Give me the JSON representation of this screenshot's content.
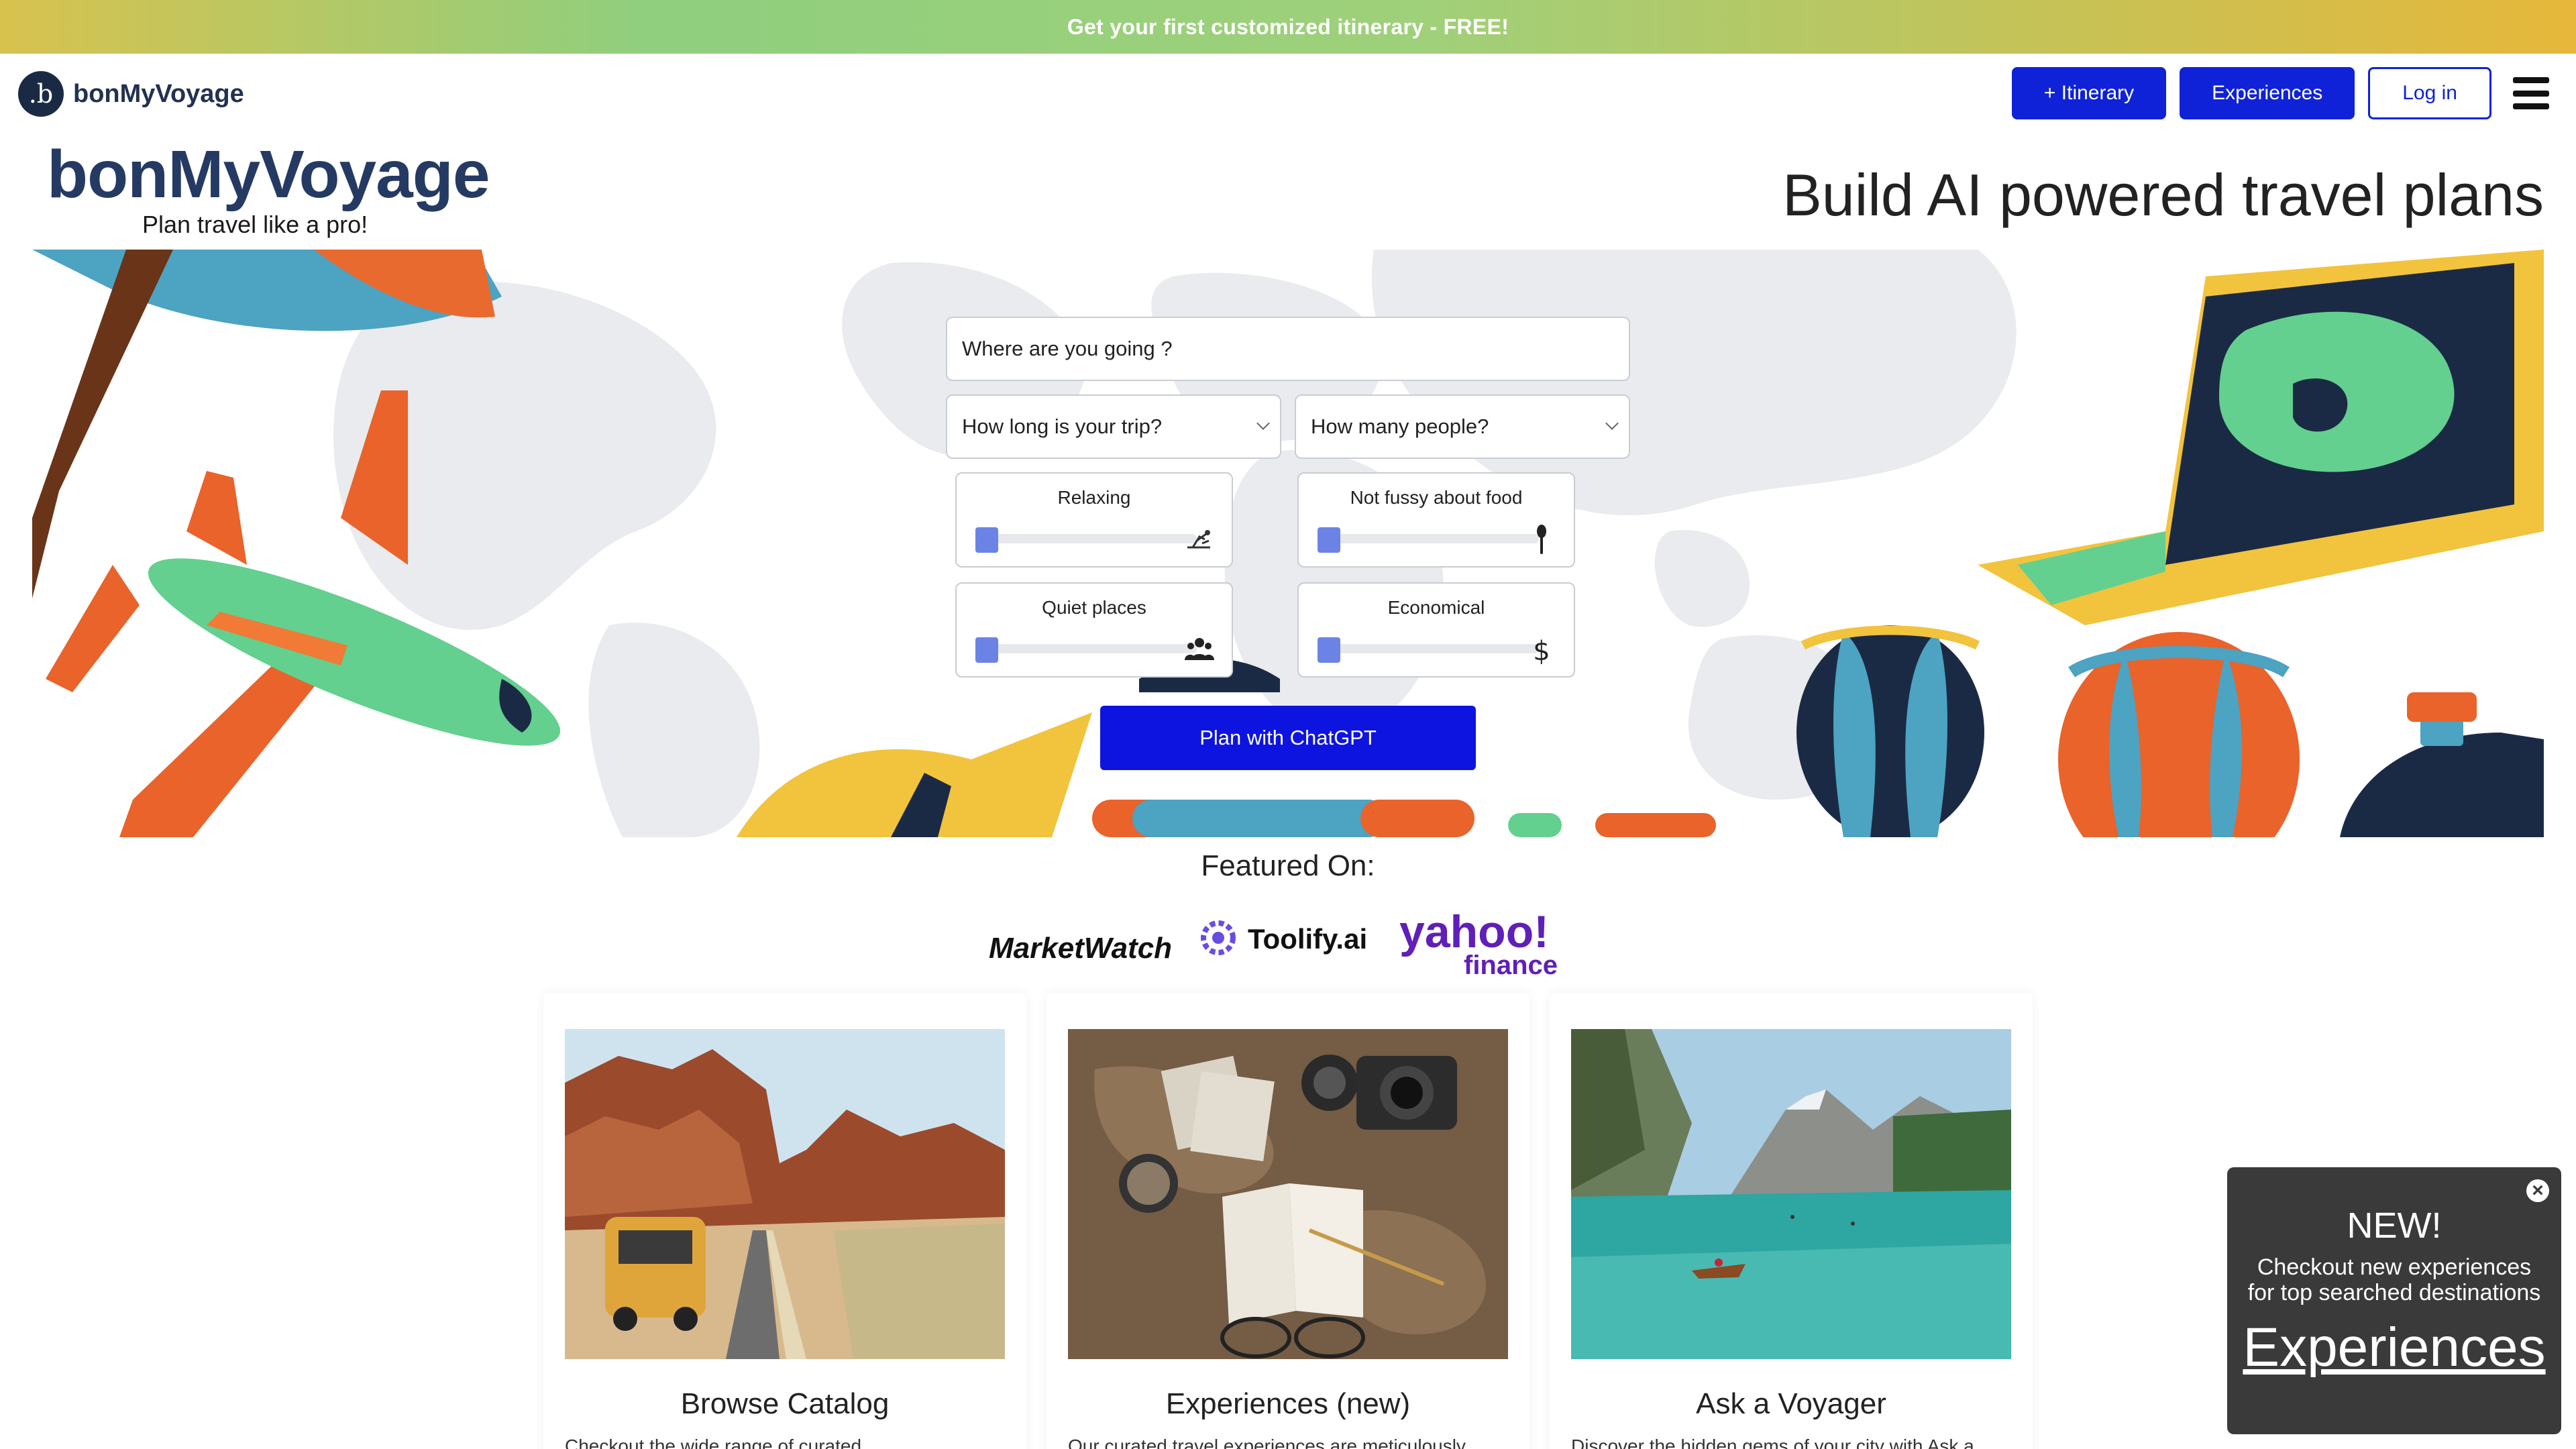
{
  "banner": {
    "text": "Get your first customized itinerary - FREE!"
  },
  "brand": {
    "logo_glyph": ".b",
    "name": "bonMyVoyage"
  },
  "nav": {
    "itinerary_label": "+ Itinerary",
    "experiences_label": "Experiences",
    "login_label": "Log in",
    "menu_icon": "hamburger-icon"
  },
  "hero": {
    "title": "bonMyVoyage",
    "tagline": "Plan travel like a pro!",
    "headline": "Build AI powered travel plans"
  },
  "form": {
    "destination_placeholder": "Where are you going ?",
    "duration_placeholder": "How long is your trip?",
    "people_placeholder": "How many people?",
    "preferences": [
      {
        "label": "Relaxing",
        "icon": "relax-icon",
        "value": 0
      },
      {
        "label": "Not fussy about food",
        "icon": "spoon-icon",
        "value": 0
      },
      {
        "label": "Quiet places",
        "icon": "users-icon",
        "value": 0
      },
      {
        "label": "Economical",
        "icon": "dollar-icon",
        "value": 0
      }
    ],
    "submit_label": "Plan with ChatGPT"
  },
  "featured": {
    "title": "Featured On:",
    "logos": [
      "MarketWatch",
      "Toolify.ai",
      "yahoo!",
      "finance"
    ]
  },
  "cards": [
    {
      "title": "Browse Catalog",
      "desc": "Checkout the wide range of curated"
    },
    {
      "title": "Experiences (new)",
      "desc": "Our curated travel experiences are meticulously"
    },
    {
      "title": "Ask a Voyager",
      "desc": "Discover the hidden gems of your city with Ask a"
    }
  ],
  "toast": {
    "title": "NEW!",
    "line1": "Checkout new experiences",
    "line2": "for top searched destinations",
    "link": "Experiences"
  },
  "colors": {
    "brand_navy": "#253a63",
    "button_blue": "#0f22d8",
    "slider_thumb": "#6c83e6"
  }
}
